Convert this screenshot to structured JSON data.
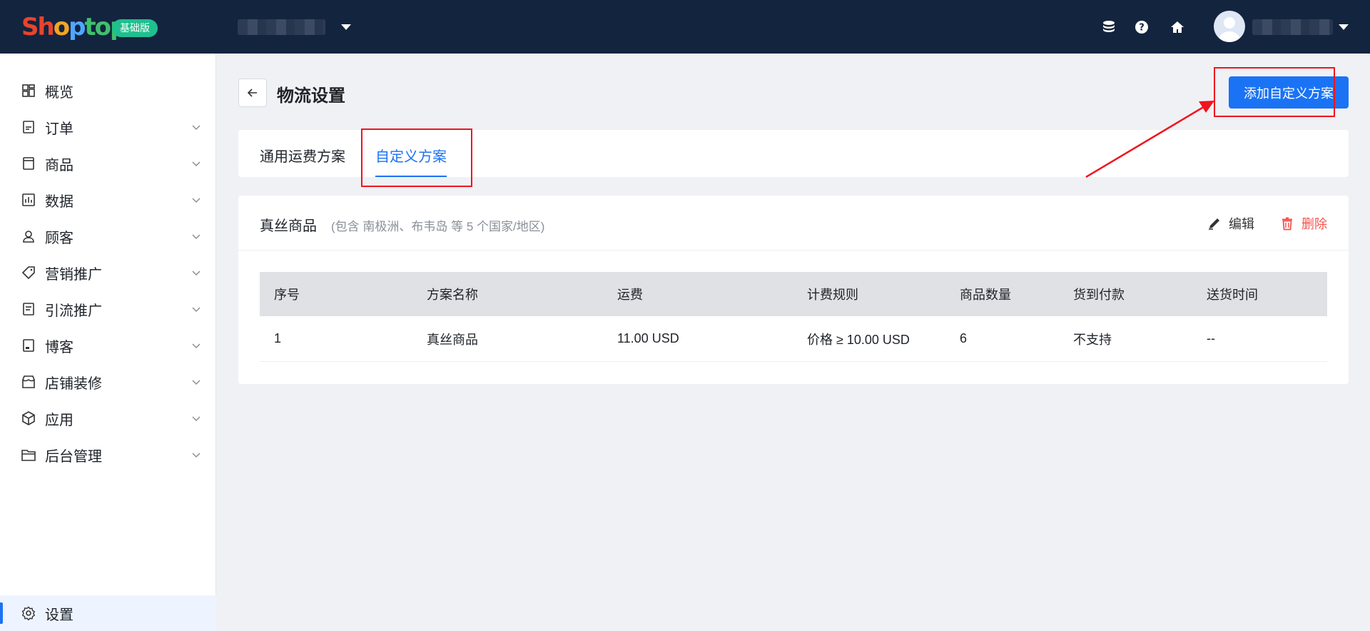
{
  "header": {
    "logo_parts": [
      "Sh",
      "o",
      "p",
      "top"
    ],
    "edition_badge": "基础版"
  },
  "sidebar": {
    "items": [
      {
        "label": "概览",
        "icon": "dashboard-icon"
      },
      {
        "label": "订单",
        "icon": "order-icon"
      },
      {
        "label": "商品",
        "icon": "product-icon"
      },
      {
        "label": "数据",
        "icon": "chart-icon"
      },
      {
        "label": "顾客",
        "icon": "user-icon"
      },
      {
        "label": "营销推广",
        "icon": "tag-icon"
      },
      {
        "label": "引流推广",
        "icon": "traffic-icon"
      },
      {
        "label": "博客",
        "icon": "blog-icon"
      },
      {
        "label": "店铺装修",
        "icon": "store-icon"
      },
      {
        "label": "应用",
        "icon": "app-icon"
      },
      {
        "label": "后台管理",
        "icon": "folder-icon"
      }
    ],
    "settings_label": "设置"
  },
  "page": {
    "title": "物流设置",
    "add_button": "添加自定义方案",
    "tabs": [
      "通用运费方案",
      "自定义方案"
    ],
    "active_tab": "自定义方案"
  },
  "plan": {
    "name": "真丝商品",
    "region_note": "(包含 南极洲、布韦岛 等 5 个国家/地区)",
    "edit_label": "编辑",
    "delete_label": "删除",
    "table": {
      "headers": [
        "序号",
        "方案名称",
        "运费",
        "计费规则",
        "商品数量",
        "货到付款",
        "送货时间"
      ],
      "rows": [
        [
          "1",
          "真丝商品",
          "11.00 USD",
          "价格 ≥ 10.00 USD",
          "6",
          "不支持",
          "--"
        ]
      ]
    }
  },
  "colors": {
    "accent": "#1a73f5",
    "topbar": "#13243f",
    "danger": "#f5534d",
    "annotation": "#f0141e"
  }
}
